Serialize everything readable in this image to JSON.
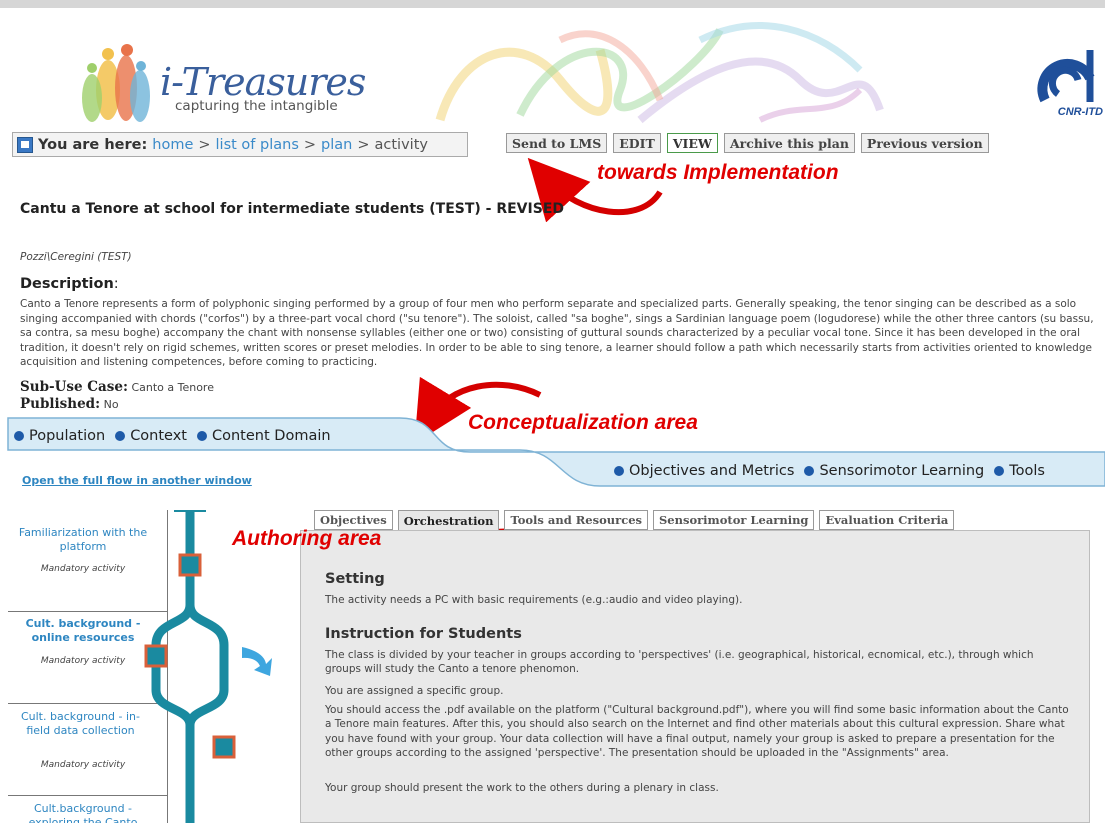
{
  "header": {
    "logo_title": "i-Treasures",
    "logo_subtitle": "capturing the intangible",
    "partner_logo_text": "CNR-ITD"
  },
  "breadcrumb": {
    "label": "You are here:",
    "items": [
      "home",
      "list of plans",
      "plan",
      "activity"
    ]
  },
  "actions": {
    "send_lms": "Send to LMS",
    "edit": "EDIT",
    "view": "VIEW",
    "archive": "Archive this plan",
    "previous": "Previous version"
  },
  "annotations": {
    "implementation": "towards Implementation",
    "conceptualization": "Conceptualization area",
    "authoring": "Authoring area"
  },
  "plan": {
    "title": "Cantu a Tenore at school for intermediate students (TEST) - REVISED",
    "authors": "Pozzi\\Ceregini (TEST)",
    "description_heading": "Description",
    "description_colon": ":",
    "description": "Canto a Tenore represents a form of polyphonic singing performed by a group of four men who perform separate and specialized parts. Generally speaking, the tenor singing can be described as a solo singing accompanied with chords (\"corfos\") by a three-part vocal chord (\"su tenore\"). The soloist, called \"sa boghe\", sings a Sardinian language poem (logudorese) while the other three cantors (su bassu, sa contra, sa mesu boghe) accompany the chant with nonsense syllables (either one or two) consisting of guttural sounds characterized by a peculiar vocal tone. Since it has been developed in the oral tradition, it doesn't rely on rigid schemes, written scores or preset melodies. In order to be able to sing tenore, a learner should follow a path which necessarily starts from activities oriented to knowledge acquisition and listening competences, before coming to practicing.",
    "subuse_label": "Sub-Use Case:",
    "subuse_value": "Canto a Tenore",
    "published_label": "Published:",
    "published_value": "No"
  },
  "conceptualization": {
    "row1": [
      "Population",
      "Context",
      "Content Domain"
    ],
    "row2": [
      "Objectives and Metrics",
      "Sensorimotor Learning",
      "Tools"
    ]
  },
  "open_flow_link": "Open the full flow in another window",
  "activities": [
    {
      "title": "Familiarization with the platform",
      "status": "Mandatory activity",
      "active": false
    },
    {
      "title": "Cult. background - online resources",
      "status": "Mandatory activity",
      "active": true
    },
    {
      "title": "Cult. background - in-field data collection",
      "status": "Mandatory activity",
      "active": false
    },
    {
      "title": "Cult.background - exploring the Canto",
      "status": "",
      "active": false
    }
  ],
  "tabs": [
    "Objectives",
    "Orchestration",
    "Tools and Resources",
    "Sensorimotor Learning",
    "Evaluation Criteria"
  ],
  "active_tab": "Orchestration",
  "orchestration": {
    "setting_heading": "Setting",
    "setting_text": "The activity needs a PC with basic requirements (e.g.:audio and video playing).",
    "instruction_heading": "Instruction for Students",
    "paragraphs": [
      "The class is divided by your teacher in groups according to 'perspectives' (i.e. geographical, historical, ecnomical, etc.), through which groups will study the Canto a tenore phenomon.",
      "You are assigned a specific group.",
      "You should access the .pdf available on the platform (\"Cultural background.pdf\"), where you will find some basic information about the Canto a Tenore main features. After this, you should also search on the Internet and find other materials about this cultural expression. Share what you have found with your group. Your data collection will have a final output, namely your group is asked to prepare a presentation for the other groups according to the assigned 'perspective'. The presentation should be uploaded in the \"Assignments\" area.",
      "Your group should present the work to the others during a plenary in class."
    ]
  },
  "colors": {
    "annotation_red": "#e00000",
    "link_blue": "#2e86c1",
    "flow_teal": "#1a8aa0",
    "node_orange": "#d9603a",
    "bar_blue": "#d8ebf6"
  }
}
